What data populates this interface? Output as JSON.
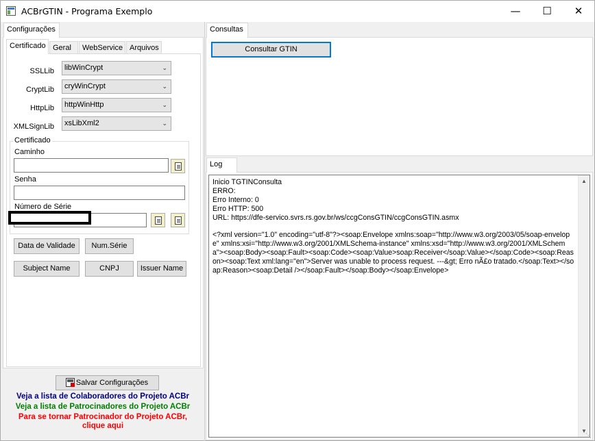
{
  "window": {
    "title": "ACBrGTIN - Programa Exemplo",
    "minimize_glyph": "—",
    "maximize_glyph": "☐",
    "close_glyph": "✕"
  },
  "left": {
    "main_tab": "Configurações",
    "subtabs": [
      "Certificado",
      "Geral",
      "WebService",
      "Arquivos"
    ],
    "combos": [
      {
        "label": "SSLLib",
        "value": "libWinCrypt"
      },
      {
        "label": "CryptLib",
        "value": "cryWinCrypt"
      },
      {
        "label": "HttpLib",
        "value": "httpWinHttp"
      },
      {
        "label": "XMLSignLib",
        "value": "xsLibXml2"
      }
    ],
    "certificado": {
      "group_label": "Certificado",
      "caminho_label": "Caminho",
      "caminho_value": "",
      "senha_label": "Senha",
      "senha_value": "",
      "numero_serie_label": "Número de Série",
      "numero_serie_value": ""
    },
    "buttons": {
      "data_validade": "Data de Validade",
      "num_serie": "Num.Série",
      "subject_name": "Subject Name",
      "cnpj": "CNPJ",
      "issuer_name": "Issuer Name"
    },
    "save_button": "Salvar Configurações",
    "links": {
      "colaboradores": "Veja a lista de Colaboradores do Projeto ACBr",
      "patrocinadores": "Veja a lista de Patrocinadores do Projeto ACBr",
      "patrocinador_line1": "Para se tornar Patrocinador do Projeto ACBr,",
      "patrocinador_line2": "clique aqui"
    },
    "colors": {
      "colaboradores": "#000080",
      "patrocinadores": "#008000",
      "patrocinador": "#ff0000"
    }
  },
  "right": {
    "consultas_tab": "Consultas",
    "consultar_button": "Consultar GTIN",
    "log_tab": "Log",
    "log_text": "Inicio TGTINConsulta\nERRO:\nErro Interno: 0\nErro HTTP: 500\nURL: https://dfe-servico.svrs.rs.gov.br/ws/ccgConsGTIN/ccgConsGTIN.asmx\n\n<?xml version=\"1.0\" encoding=\"utf-8\"?><soap:Envelope xmlns:soap=\"http://www.w3.org/2003/05/soap-envelope\" xmlns:xsi=\"http://www.w3.org/2001/XMLSchema-instance\" xmlns:xsd=\"http://www.w3.org/2001/XMLSchema\"><soap:Body><soap:Fault><soap:Code><soap:Value>soap:Receiver</soap:Value></soap:Code><soap:Reason><soap:Text xml:lang=\"en\">Server was unable to process request. ---&gt; Erro nÃ£o tratado.</soap:Text></soap:Reason><soap:Detail /></soap:Fault></soap:Body></soap:Envelope>"
  }
}
